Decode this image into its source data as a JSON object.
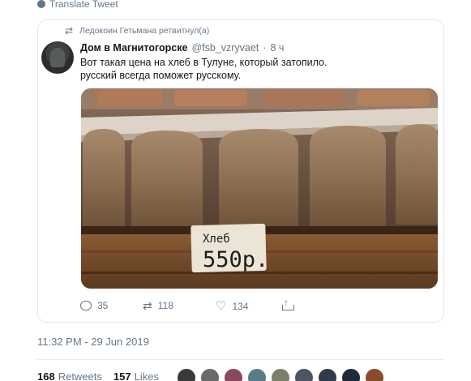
{
  "translate": {
    "label": "Translate Tweet",
    "icon": "globe-icon"
  },
  "quoted": {
    "retweeted_by": "Ледокоин Гетьмана ретвитнул(а)",
    "author_name": "Дом в Магнитогорске",
    "author_handle": "@fsb_vzryvaet",
    "separator": "·",
    "time": "8 ч",
    "text_lines": [
      "Вот такая цена на хлеб в Тулуне, который затопило.",
      "русский всегда поможет русскому."
    ],
    "photo": {
      "sign_word": "Хлеб",
      "sign_price": "550р."
    },
    "actions": {
      "replies": "35",
      "retweets": "118",
      "likes": "134"
    }
  },
  "timestamp": "11:32 PM - 29 Jun 2019",
  "stats": {
    "retweets_count": "168",
    "retweets_label": "Retweets",
    "likes_count": "157",
    "likes_label": "Likes"
  },
  "likers": [
    "#3a3a3a",
    "#6b6b6b",
    "#8a4a5e",
    "#5b7a8c",
    "#7c7f6a",
    "#4b5563",
    "#2f3b4a",
    "#1f2937",
    "#8b4a2b"
  ],
  "colors": {
    "text": "#14171a",
    "muted": "#657786",
    "border": "#e1e8ed"
  }
}
